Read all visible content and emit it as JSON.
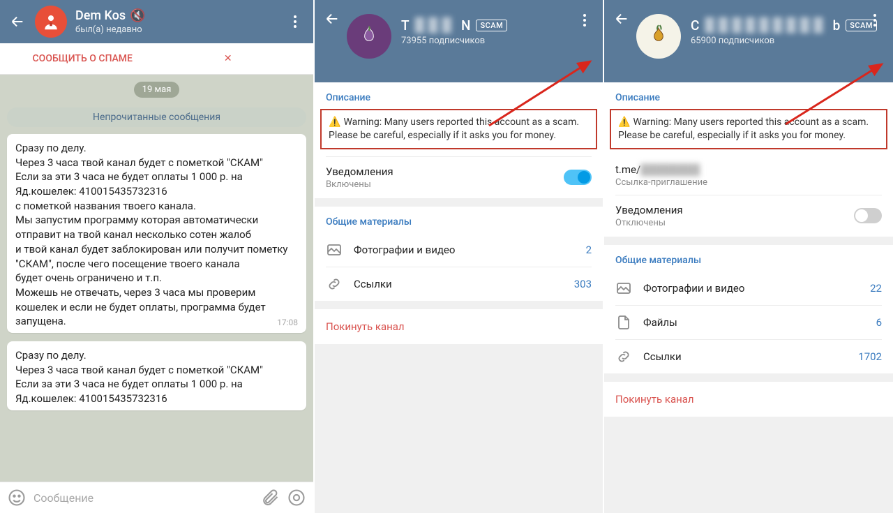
{
  "panel1": {
    "name": "Dem Kos",
    "status": "был(а) недавно",
    "spam": "СООБЩИТЬ О СПАМЕ",
    "date": "19 мая",
    "unread": "Непрочитанные сообщения",
    "msg1": "Сразу по делу.\nЧерез 3 часа твой канал будет с пометкой \"СКАМ\"\nЕсли за эти 3 часа не будет оплаты 1 000 р. на Яд.кошелек: 410015435732316\nс пометкой названия твоего канала.\nМы запустим программу которая автоматически отправит на твой канал несколько сотен жалоб\nи твой канал будет заблокирован или получит пометку \"СКАМ\", после чего посещение твоего канала\nбудет очень ограничено и т.п.\nМожешь не отвечать, через 3 часа мы проверим кошелек и если не будет оплаты, программа будет запущена.",
    "msg1_time": "17:08",
    "msg2": "Сразу по делу.\nЧерез 3 часа твой канал будет с пометкой \"СКАМ\"\nЕсли за эти 3 часа не будет оплаты 1 000 р. на Яд.кошелек: 410015435732316",
    "placeholder": "Сообщение"
  },
  "panel2": {
    "name_pre": "T",
    "name_post": "N",
    "scam": "SCAM",
    "subs": "73955 подписчиков",
    "desc_title": "Описание",
    "warning": "Warning: Many users reported this account as a scam. Please be careful, especially if it asks you for money.",
    "notif_label": "Уведомления",
    "notif_state": "Включены",
    "materials": "Общие материалы",
    "photos": "Фотографии и видео",
    "photos_n": "2",
    "links": "Ссылки",
    "links_n": "303",
    "leave": "Покинуть канал"
  },
  "panel3": {
    "name_pre": "C",
    "name_post": "b",
    "scam": "SCAM",
    "subs": "65900 подписчиков",
    "desc_title": "Описание",
    "warning": "Warning: Many users reported this account as a scam. Please be careful, especially if it asks you for money.",
    "link": "t.me/",
    "link_sub": "Ссылка-приглашение",
    "notif_label": "Уведомления",
    "notif_state": "Отключены",
    "materials": "Общие материалы",
    "photos": "Фотографии и видео",
    "photos_n": "22",
    "files": "Файлы",
    "files_n": "6",
    "links": "Ссылки",
    "links_n": "1702",
    "leave": "Покинуть канал"
  }
}
